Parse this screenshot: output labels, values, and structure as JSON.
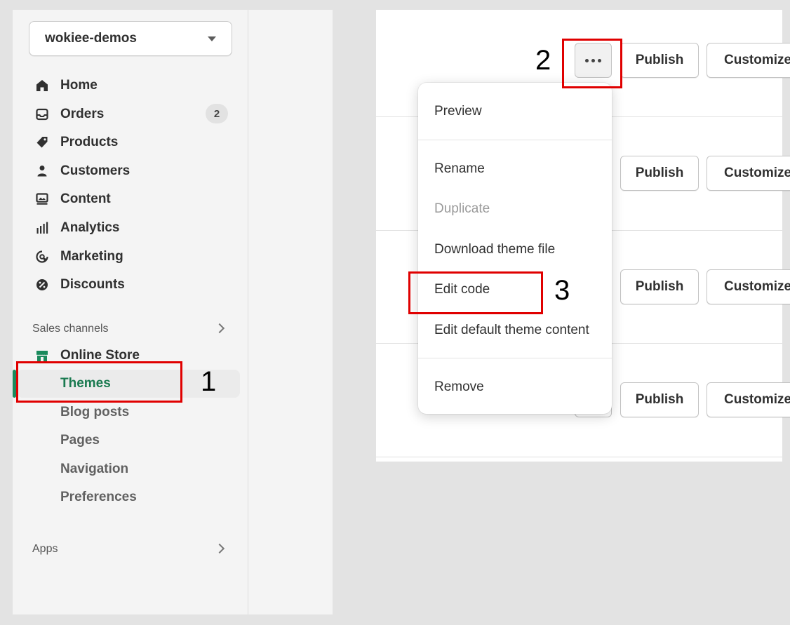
{
  "sidebar": {
    "store_name": "wokiee-demos",
    "items": [
      {
        "label": "Home",
        "icon": "home-icon"
      },
      {
        "label": "Orders",
        "icon": "orders-icon",
        "badge": "2"
      },
      {
        "label": "Products",
        "icon": "tag-icon"
      },
      {
        "label": "Customers",
        "icon": "person-icon"
      },
      {
        "label": "Content",
        "icon": "content-icon"
      },
      {
        "label": "Analytics",
        "icon": "analytics-icon"
      },
      {
        "label": "Marketing",
        "icon": "marketing-icon"
      },
      {
        "label": "Discounts",
        "icon": "discount-icon"
      }
    ],
    "sales_channels_label": "Sales channels",
    "online_store_label": "Online Store",
    "online_store_subitems": [
      "Themes",
      "Blog posts",
      "Pages",
      "Navigation",
      "Preferences"
    ],
    "apps_label": "Apps"
  },
  "themes": {
    "publish_label": "Publish",
    "customize_label": "Customize"
  },
  "menu": {
    "items": [
      "Preview",
      "Rename",
      "Duplicate",
      "Download theme file",
      "Edit code",
      "Edit default theme content",
      "Remove"
    ]
  },
  "annotations": {
    "step1": "1",
    "step2": "2",
    "step3": "3"
  },
  "colors": {
    "accent_green": "#1a8a5c",
    "annotation_red": "#e00000"
  }
}
